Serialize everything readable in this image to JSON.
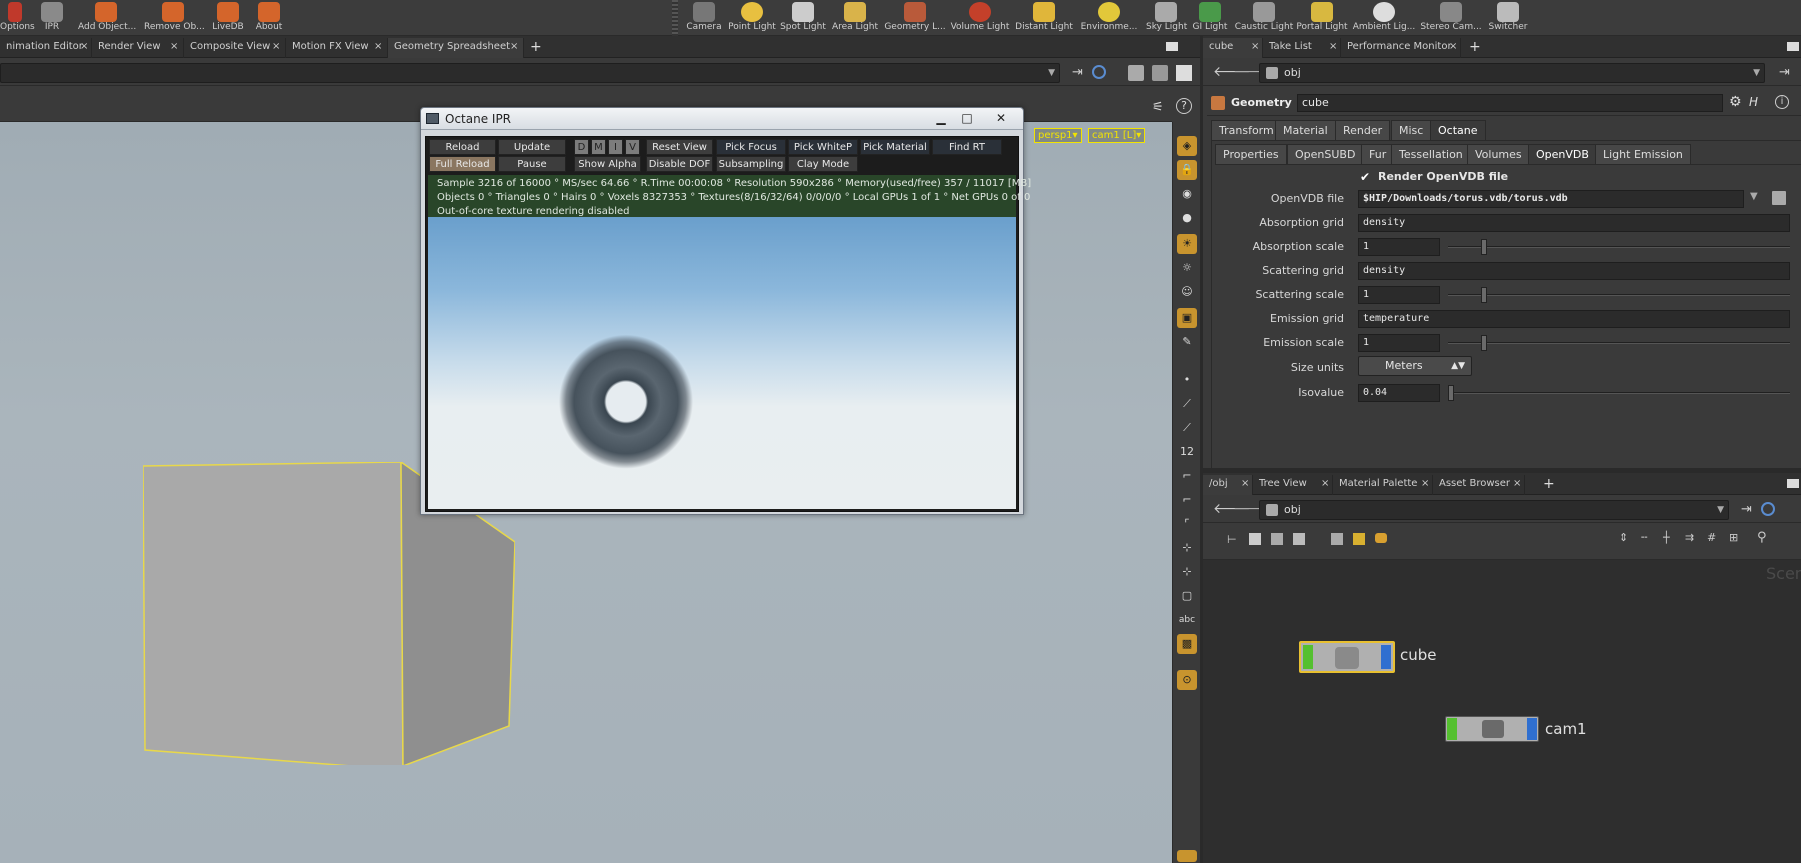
{
  "shelf": {
    "left_tools": [
      "Options",
      "IPR",
      "Add Object...",
      "Remove Ob...",
      "LiveDB",
      "About"
    ],
    "light_tools": [
      "Camera",
      "Point Light",
      "Spot Light",
      "Area Light",
      "Geometry L...",
      "Volume Light",
      "Distant Light",
      "Environme...",
      "Sky Light",
      "GI Light",
      "Caustic Light",
      "Portal Light",
      "Ambient Lig...",
      "Stereo Cam...",
      "Switcher"
    ]
  },
  "left_tabs": [
    "nimation Editor",
    "Render View",
    "Composite View",
    "Motion FX View",
    "Geometry Spreadsheet"
  ],
  "right_tabs": [
    "cube",
    "Take List",
    "Performance Monitor"
  ],
  "network_tabs": [
    "/obj",
    "Tree View",
    "Material Palette",
    "Asset Browser"
  ],
  "param_path": "obj",
  "network_path": "obj",
  "viewport": {
    "persp_label": "persp1",
    "cam_label": "cam1 [L]"
  },
  "ipr": {
    "title": "Octane IPR",
    "row1": [
      "Reload",
      "Update",
      "D",
      "M",
      "I",
      "V",
      "Reset View",
      "Pick Focus",
      "Pick WhiteP",
      "Pick Material",
      "Find RT"
    ],
    "row2": [
      "Full Reload",
      "Pause",
      "Show Alpha",
      "Disable DOF",
      "Subsampling",
      "Clay Mode"
    ],
    "status": [
      "Sample 3216 of 16000 ° MS/sec 64.66 ° R.Time 00:00:08 ° Resolution 590x286 ° Memory(used/free) 357 / 11017 [MB]",
      "Objects 0 ° Triangles 0 ° Hairs 0 ° Voxels 8327353 ° Textures(8/16/32/64) 0/0/0/0 ° Local GPUs 1 of 1 ° Net GPUs 0 of 0",
      "Out-of-core texture rendering disabled"
    ]
  },
  "geometry": {
    "type_label": "Geometry",
    "name": "cube",
    "main_tabs": [
      "Transform",
      "Material",
      "Render",
      "Misc",
      "Octane"
    ],
    "sub_tabs": [
      "Properties",
      "OpenSUBD",
      "Fur",
      "Tessellation",
      "Volumes",
      "OpenVDB",
      "Light Emission"
    ],
    "render_openvdb": "Render OpenVDB file",
    "params": {
      "openvdb_file_label": "OpenVDB file",
      "openvdb_file": "$HIP/Downloads/torus.vdb/torus.vdb",
      "absorption_grid_label": "Absorption grid",
      "absorption_grid": "density",
      "absorption_scale_label": "Absorption scale",
      "absorption_scale": "1",
      "scattering_grid_label": "Scattering grid",
      "scattering_grid": "density",
      "scattering_scale_label": "Scattering scale",
      "scattering_scale": "1",
      "emission_grid_label": "Emission grid",
      "emission_grid": "temperature",
      "emission_scale_label": "Emission scale",
      "emission_scale": "1",
      "size_units_label": "Size units",
      "size_units": "Meters",
      "isovalue_label": "Isovalue",
      "isovalue": "0.04"
    },
    "slider_levels": {
      "absorption_scale": 0.1,
      "scattering_scale": 0.1,
      "emission_scale": 0.1,
      "isovalue": 0.0
    }
  },
  "network": {
    "corner_text": "Scen",
    "nodes": [
      "cube",
      "cam1"
    ]
  }
}
